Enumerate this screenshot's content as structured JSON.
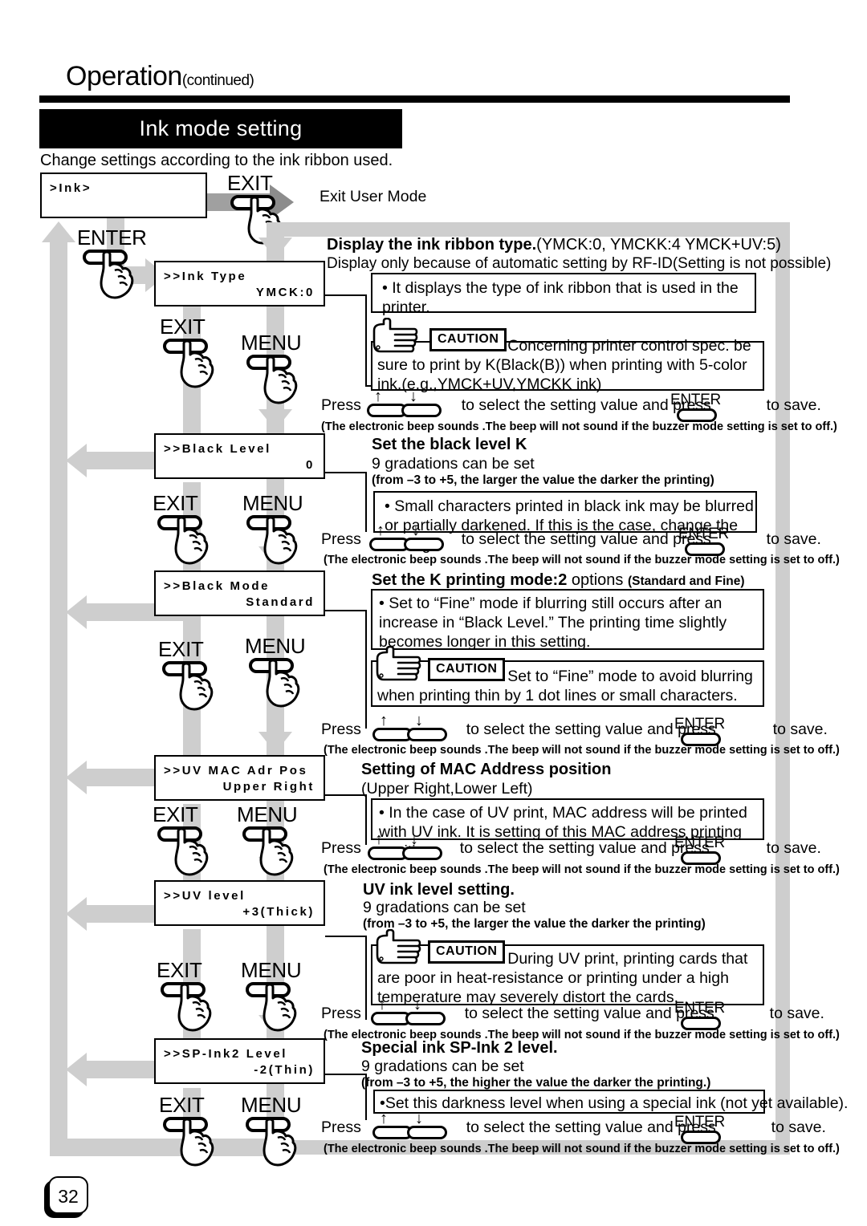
{
  "header": {
    "title": "Operation",
    "title_suffix": "(continued)",
    "section_title": "Ink mode setting",
    "lead": "Change settings according to the ink ribbon used."
  },
  "page_number": "32",
  "common": {
    "exit_label": "EXIT",
    "menu_label": "MENU",
    "enter_label": "ENTER",
    "press_prefix": "Press",
    "press_middle": "to select the setting value and press",
    "press_suffix": "to save.",
    "beep_note": "(The electronic beep sounds .The beep will not sound if the buzzer mode setting is set to off.)",
    "caution_label": "CAUTION",
    "exit_user_mode": "Exit User Mode",
    "up_arrow": "↑",
    "down_arrow": "↓"
  },
  "root_panel": {
    "line1": ">Ink>",
    "line2": ""
  },
  "steps": [
    {
      "lcd": {
        "line1": ">>Ink Type",
        "line2": "YMCK:0"
      },
      "heading_bold": "Display the ink ribbon type.",
      "heading_rest": "(YMCK:0, YMCKK:4 YMCK+UV:5)",
      "subheading": "Display only because of automatic setting by RF-ID(Setting is not possible)",
      "body": "• It displays the type of ink ribbon that is used in the printer.",
      "caution": "• Concerning printer control spec. be sure to print by K(Black(B)) when printing with 5-color ink.(e.g.,YMCK+UV,YMCKK  ink)"
    },
    {
      "lcd": {
        "line1": ">>Black Level",
        "line2": "0"
      },
      "heading_bold": "Set the black level K",
      "subheading": "9 gradations can be set",
      "range_note": "(from –3 to +5, the larger the value the darker the printing)",
      "body": "• Small characters printed in black ink may be blurred or partially darkened. If this is the case, change the setting."
    },
    {
      "lcd": {
        "line1": ">>Black Mode",
        "line2": "Standard"
      },
      "heading_bold": "Set the K printing mode:2",
      "heading_rest": "options",
      "heading_small": "(Standard and Fine)",
      "body": "• Set to “Fine” mode if blurring still occurs after an increase in “Black Level.”  The printing time slightly becomes longer in this setting.",
      "caution": "• Set to “Fine” mode to avoid blurring when printing thin by 1 dot lines or small characters."
    },
    {
      "lcd": {
        "line1": ">>UV MAC Adr Pos",
        "line2": "Upper Right"
      },
      "heading_bold": "Setting of MAC Address position",
      "subheading": "(Upper Right,Lower Left)",
      "body": "• In the case of UV print, MAC address will be printed with UV ink. It is setting of this MAC address printing position."
    },
    {
      "lcd": {
        "line1": ">>UV level",
        "line2": "+3(Thick)"
      },
      "heading_bold": "UV ink level setting.",
      "subheading": "9 gradations can be set",
      "range_note": "(from –3 to +5, the larger the value the darker the printing)",
      "caution": "• During UV print, printing cards that are poor in heat-resistance or printing under a high temperature may severely distort the cards."
    },
    {
      "lcd": {
        "line1": ">>SP-Ink2 Level",
        "line2": "-2(Thin)"
      },
      "heading_bold": "Special ink SP-Ink 2 level.",
      "subheading": "9 gradations can be set",
      "range_note": "(from –3 to +5, the higher the value the darker the printing.)",
      "body": "•Set this darkness level when using a special ink (not yet available)."
    }
  ],
  "colors": {
    "flow_gray": "#cecece",
    "exit_arrow_gray": "#8c8c8c",
    "ink": "#000000"
  }
}
